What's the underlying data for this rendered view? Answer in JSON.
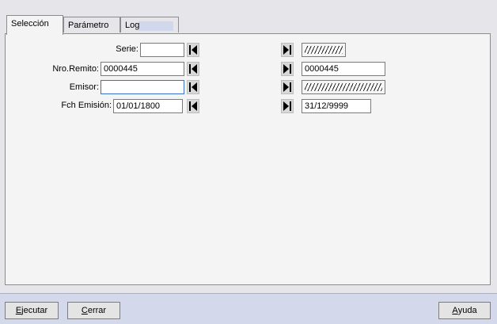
{
  "tabs": [
    {
      "label": "Selección",
      "active": true
    },
    {
      "label": "Parámetro",
      "active": false
    },
    {
      "label": "Log",
      "active": false
    }
  ],
  "form": {
    "serie": {
      "label": "Serie:",
      "from": "",
      "to": ""
    },
    "nro_remito": {
      "label": "Nro.Remito:",
      "from": "0000445",
      "to": "0000445"
    },
    "emisor": {
      "label": "Emisor:",
      "from": "",
      "to": ""
    },
    "fch_emision": {
      "label": "Fch Emisión:",
      "from": "01/01/1800",
      "to": "31/12/9999"
    }
  },
  "buttons": {
    "ejecutar": {
      "mnemonic": "E",
      "rest": "jecutar"
    },
    "cerrar": {
      "mnemonic": "C",
      "rest": "errar"
    },
    "ayuda": {
      "mnemonic": "A",
      "rest": "yuda"
    }
  },
  "icons": {
    "first": "skip-first-icon",
    "last": "skip-last-icon"
  }
}
